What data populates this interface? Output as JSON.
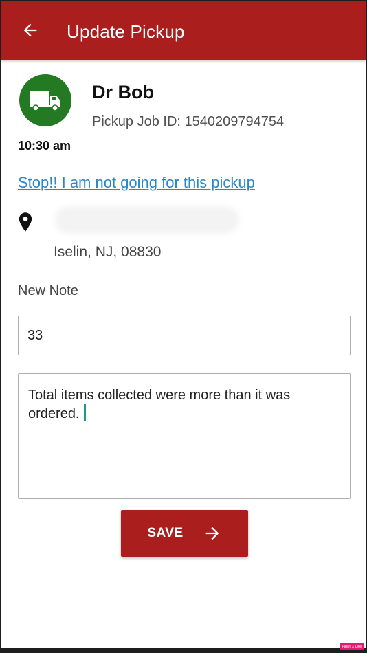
{
  "appbar": {
    "title": "Update Pickup",
    "back_icon": "arrow-left-icon",
    "color": "#aa1e1e"
  },
  "pickup": {
    "avatar_icon": "truck-icon",
    "avatar_color": "#237a22",
    "customer_name": "Dr Bob",
    "job_id_text": "Pickup Job ID: 1540209794754",
    "time": "10:30 am",
    "cancel_link": "Stop!! I am not going for this pickup",
    "location_icon": "map-pin-icon",
    "address_city": "Iselin, NJ, 08830"
  },
  "note": {
    "label": "New Note",
    "quantity_value": "33",
    "text": "Total items collected were more than it was ordered."
  },
  "save": {
    "label": "SAVE",
    "icon": "arrow-right-icon"
  },
  "watermark": "Paint X Lite"
}
